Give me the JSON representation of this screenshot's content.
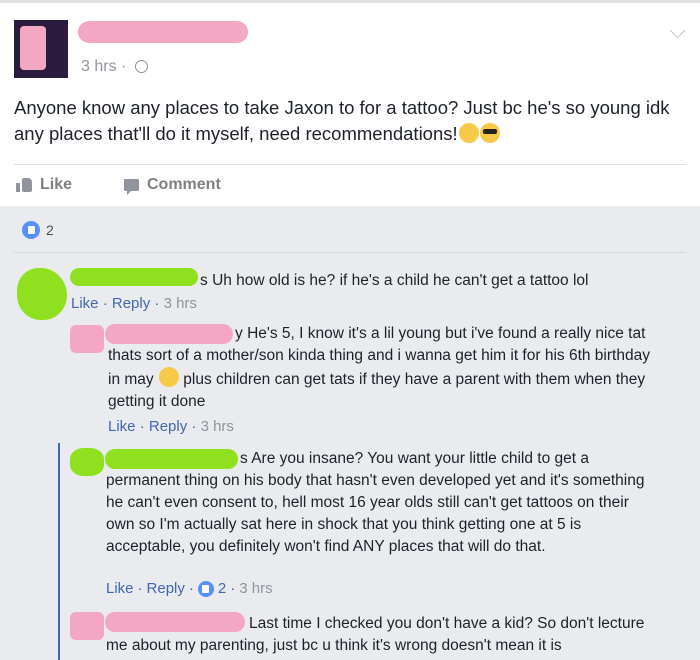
{
  "post": {
    "time": "3 hrs",
    "text": "Anyone know any places to take Jaxon to for a tattoo? Just bc he's so young idk any places that'll do it myself, need recommendations!",
    "actions": {
      "like": "Like",
      "comment": "Comment"
    },
    "reaction_count": "2"
  },
  "comments": [
    {
      "name_suffix": "s",
      "text": "Uh how old is he? if he's a child he can't get a tattoo lol",
      "like": "Like",
      "reply": "Reply",
      "time": "3 hrs"
    },
    {
      "name_suffix": "y",
      "text": "He's 5, I know it's a lil young but i've found a really nice tat thats sort of a mother/son kinda thing and i wanna get him it for his 6th birthday in may",
      "text_after_emoji": "plus children can get tats if they have a parent with them when they getting it done",
      "like": "Like",
      "reply": "Reply",
      "time": "3 hrs"
    },
    {
      "name_suffix": "s",
      "text": "Are you insane? You want your little child to get a permanent thing on his body that hasn't even developed yet and it's something he can't even consent to, hell most 16 year olds still can't get tattoos on their own so I'm actually sat here in shock that you think getting one at 5 is acceptable, you definitely won't find ANY places that will do that.",
      "like": "Like",
      "reply": "Reply",
      "reactions": "2",
      "time": "3 hrs"
    },
    {
      "text": "Last time I checked you don't have a kid? So don't lecture me about my parenting, just bc u think it's wrong doesn't mean it is"
    }
  ],
  "colors": {
    "link": "#4267b2",
    "meta": "#90949c",
    "pink_redaction": "#f3a7c3",
    "green_redaction": "#7fe000"
  }
}
